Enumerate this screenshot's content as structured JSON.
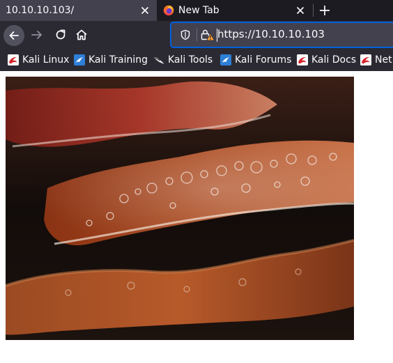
{
  "tabs": [
    {
      "title": "10.10.10.103/",
      "active": true
    },
    {
      "title": "New Tab",
      "active": false,
      "icon": "firefox-icon"
    }
  ],
  "navbar": {
    "url": "https://10.10.10.103"
  },
  "bookmarks": [
    {
      "label": "Kali Linux",
      "icon": "kali-dragon-red-icon"
    },
    {
      "label": "Kali Training",
      "icon": "kali-training-blue-icon"
    },
    {
      "label": "Kali Tools",
      "icon": "kali-dragon-black-icon"
    },
    {
      "label": "Kali Forums",
      "icon": "kali-forums-blue-icon"
    },
    {
      "label": "Kali Docs",
      "icon": "kali-dragon-red-icon"
    },
    {
      "label": "Net",
      "icon": "kali-dragon-red-icon"
    }
  ],
  "page": {
    "image": "bacon-sizzling-photo"
  },
  "colors": {
    "tabstrip_bg": "#1c1b22",
    "active_tab_bg": "#42414d",
    "toolbar_bg": "#2b2a33",
    "urlbar_focus_border": "#0060df",
    "warning_yellow": "#ffa436"
  }
}
